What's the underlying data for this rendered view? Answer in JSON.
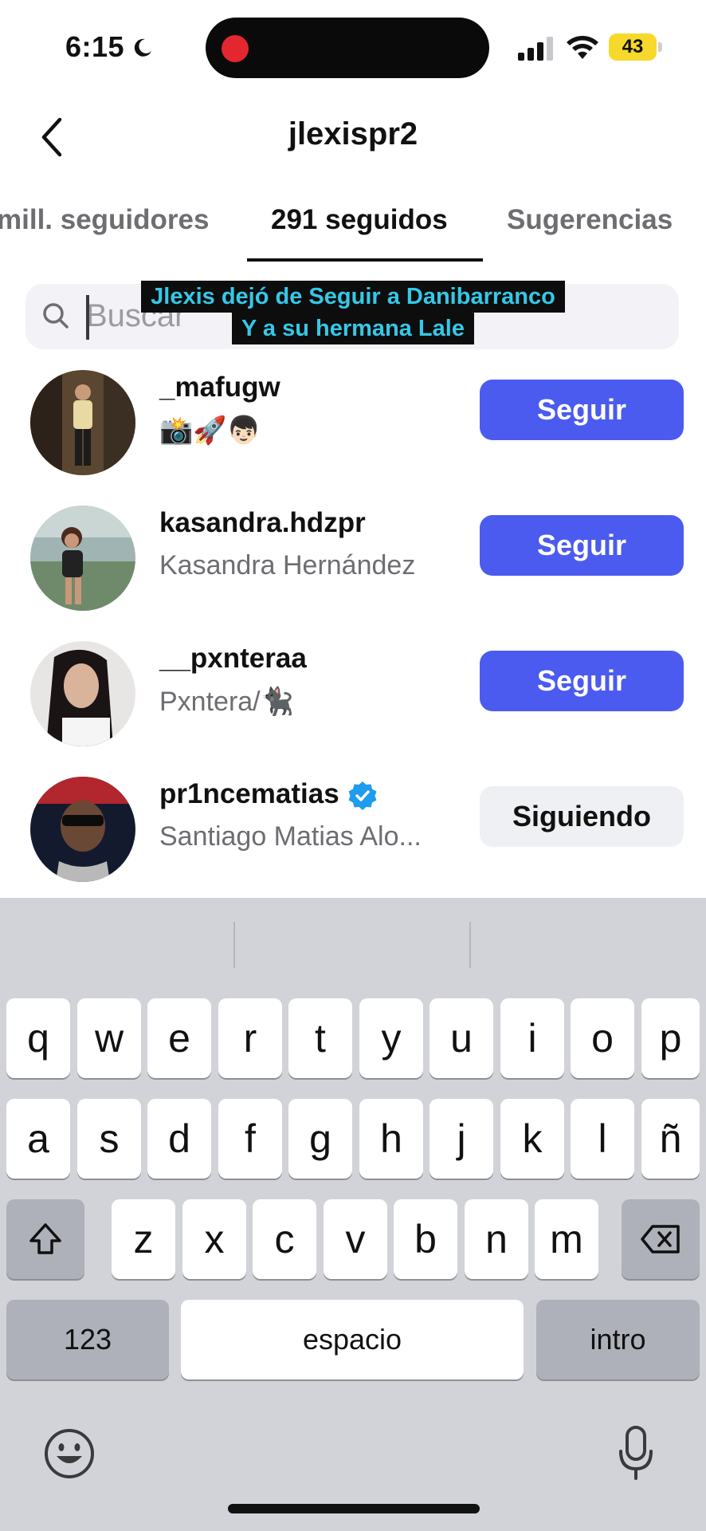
{
  "status_bar": {
    "time": "6:15",
    "battery": "43",
    "moon_icon": "moon-icon",
    "colors": {
      "battery": "#f6d92a",
      "record": "#e3262f"
    }
  },
  "header": {
    "title": "jlexispr2",
    "back_icon": "chevron-left-icon"
  },
  "tabs": [
    {
      "label": "mill. seguidores",
      "active": false
    },
    {
      "label": "291 seguidos",
      "active": true
    },
    {
      "label": "Sugerencias",
      "active": false
    }
  ],
  "search": {
    "placeholder": "Buscar"
  },
  "caption": {
    "line1": "Jlexis dejó de Seguir a Danibarranco",
    "line2": "Y a su hermana Lale"
  },
  "users": [
    {
      "username": "_mafugw",
      "subtitle": "📸🚀👦🏻",
      "verified": false,
      "button": "Seguir"
    },
    {
      "username": "kasandra.hdzpr",
      "subtitle": "Kasandra Hernández",
      "verified": false,
      "button": "Seguir"
    },
    {
      "username": "__pxnteraa",
      "subtitle": "Pxntera/🐈‍⬛",
      "verified": false,
      "button": "Seguir"
    },
    {
      "username": "pr1ncematias",
      "subtitle": "Santiago Matias Alo...",
      "verified": true,
      "button": "Siguiendo"
    }
  ],
  "keyboard": {
    "row1": [
      "q",
      "w",
      "e",
      "r",
      "t",
      "y",
      "u",
      "i",
      "o",
      "p"
    ],
    "row2": [
      "a",
      "s",
      "d",
      "f",
      "g",
      "h",
      "j",
      "k",
      "l",
      "ñ"
    ],
    "row3": [
      "z",
      "x",
      "c",
      "v",
      "b",
      "n",
      "m"
    ],
    "numbers_key": "123",
    "space_key": "espacio",
    "return_key": "intro"
  },
  "colors": {
    "accent": "#4b5bf0",
    "caption_text": "#35c8e8",
    "verified": "#1f9bf0"
  }
}
